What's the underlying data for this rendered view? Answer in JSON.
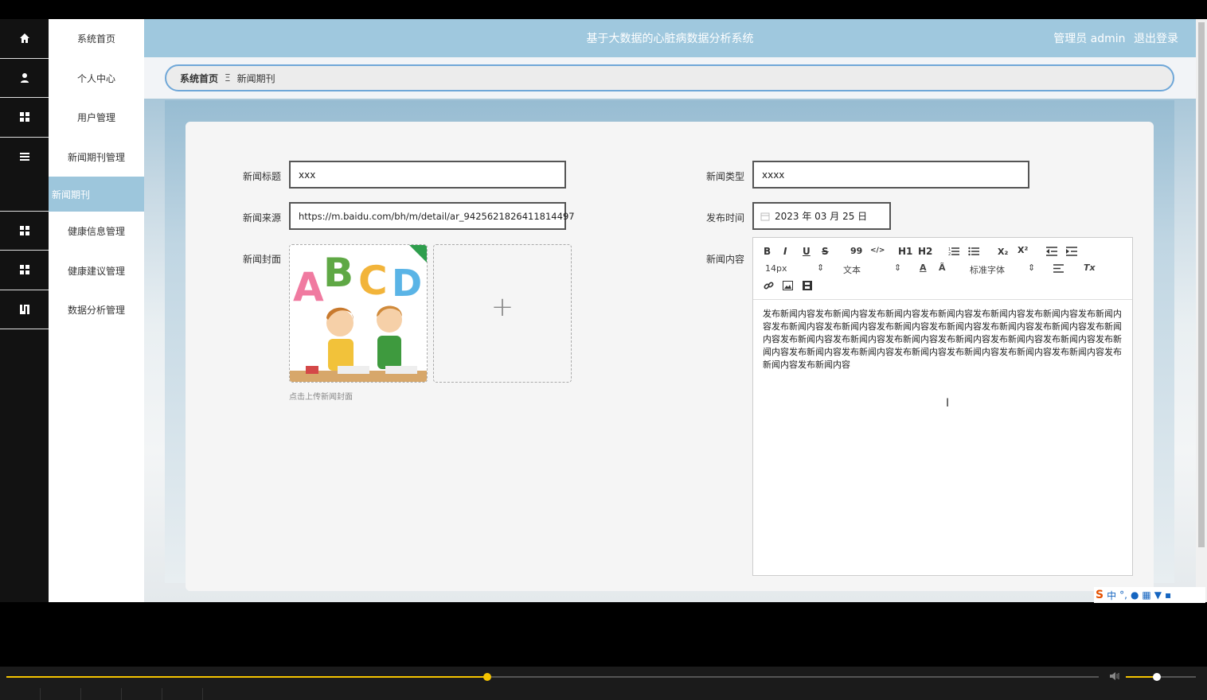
{
  "app": {
    "title": "基于大数据的心脏病数据分析系统",
    "user_label": "管理员 admin",
    "logout_label": "退出登录"
  },
  "sidebar": {
    "items": [
      {
        "label": "系统首页",
        "icon": "home-icon"
      },
      {
        "label": "个人中心",
        "icon": "user-icon"
      },
      {
        "label": "用户管理",
        "icon": "grid-icon"
      },
      {
        "label": "新闻期刊管理",
        "icon": "list-icon"
      },
      {
        "label": "健康信息管理",
        "icon": "grid-icon"
      },
      {
        "label": "健康建议管理",
        "icon": "grid-icon"
      },
      {
        "label": "数据分析管理",
        "icon": "book-icon"
      }
    ],
    "submenu_active": "新闻期刊"
  },
  "breadcrumb": {
    "home": "系统首页",
    "separator": "Ξ",
    "current": "新闻期刊"
  },
  "form": {
    "title_label": "新闻标题",
    "title_value": "xxx",
    "type_label": "新闻类型",
    "type_value": "xxxx",
    "source_label": "新闻来源",
    "source_value": "https://m.baidu.com/bh/m/detail/ar_9425621826411814497",
    "date_label": "发布时间",
    "date_value": "2023 年 03 月 25 日",
    "cover_label": "新闻封面",
    "cover_hint": "点击上传新闻封面",
    "cover_letters": [
      "A",
      "B",
      "C",
      "D"
    ],
    "add_icon": "+",
    "content_label": "新闻内容"
  },
  "editor": {
    "toolbar": {
      "bold": "B",
      "italic": "I",
      "underline": "U",
      "strike": "S",
      "quote": "99",
      "code": "</>",
      "h1": "H1",
      "h2": "H2",
      "subscript": "X₂",
      "superscript": "X²",
      "size_value": "14px",
      "header_value": "文本",
      "font_value": "标准字体",
      "clean": "Tx"
    },
    "content": "发布新闻内容发布新闻内容发布新闻内容发布新闻内容发布新闻内容发布新闻内容发布新闻内容发布新闻内容发布新闻内容发布新闻内容发布新闻内容发布新闻内容发布新闻内容发布新闻内容发布新闻内容发布新闻内容发布新闻内容发布新闻内容发布新闻内容发布新闻内容发布新闻内容发布新闻内容发布新闻内容发布新闻内容发布新闻内容发布新闻内容发布新闻内容发布新闻内容发布新闻内容"
  },
  "ime": {
    "logo": "S",
    "lang": "中",
    "punct": "°,"
  },
  "player": {
    "progress": 0.44,
    "volume": 0.44
  },
  "colors": {
    "accent": "#9fc8de",
    "rail": "#121212",
    "progress": "#f5c400"
  }
}
